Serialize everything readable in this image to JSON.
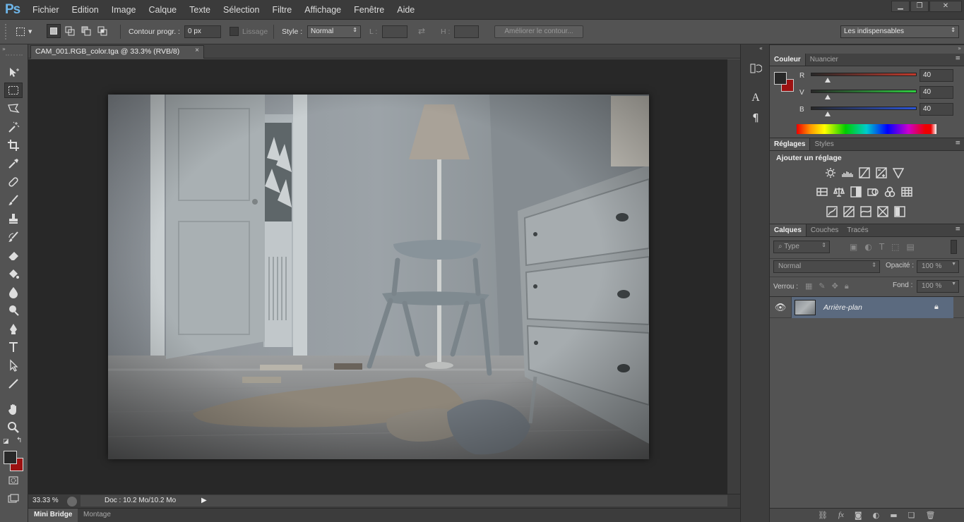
{
  "app": {
    "logo": "Ps"
  },
  "menu": [
    "Fichier",
    "Edition",
    "Image",
    "Calque",
    "Texte",
    "Sélection",
    "Filtre",
    "Affichage",
    "Fenêtre",
    "Aide"
  ],
  "window_buttons": [
    "minimize",
    "restore",
    "close"
  ],
  "options": {
    "feather_label": "Contour progr. :",
    "feather_value": "0 px",
    "antialias_label": "Lissage",
    "style_label": "Style :",
    "style_value": "Normal",
    "width_label": "L :",
    "height_label": "H :",
    "refine_edge": "Améliorer le contour...",
    "workspace": "Les indispensables"
  },
  "document": {
    "tab_title": "CAM_001.RGB_color.tga @ 33.3% (RVB/8)",
    "zoom": "33.33 %",
    "doc_info": "Doc : 10.2 Mo/10.2 Mo"
  },
  "bottom_tabs": [
    "Mini Bridge",
    "Montage"
  ],
  "color_panel": {
    "tabs": [
      "Couleur",
      "Nuancier"
    ],
    "channels": [
      {
        "label": "R",
        "value": "40",
        "color": "#c0392b"
      },
      {
        "label": "V",
        "value": "40",
        "color": "#2ecc40"
      },
      {
        "label": "B",
        "value": "40",
        "color": "#2b54d6"
      }
    ],
    "foreground": "#282828",
    "background": "#9b1111"
  },
  "adjustments_panel": {
    "tabs": [
      "Réglages",
      "Styles"
    ],
    "title": "Ajouter un réglage"
  },
  "layers_panel": {
    "tabs": [
      "Calques",
      "Couches",
      "Tracés"
    ],
    "filter": "Type",
    "blend_mode": "Normal",
    "opacity_label": "Opacité :",
    "opacity_value": "100 %",
    "lock_label": "Verrou :",
    "fill_label": "Fond :",
    "fill_value": "100 %",
    "layers": [
      {
        "name": "Arrière-plan",
        "locked": true,
        "visible": true
      }
    ]
  }
}
